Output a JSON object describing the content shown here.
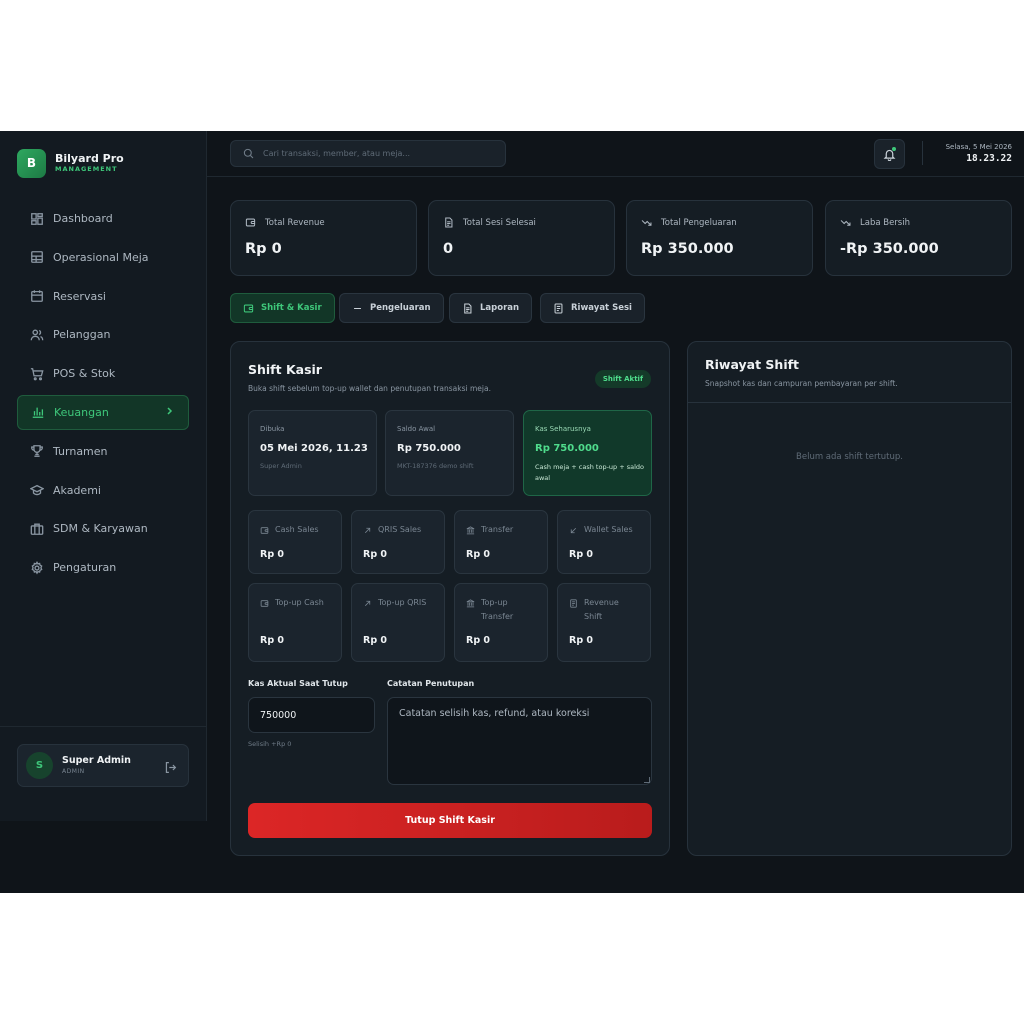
{
  "brand": {
    "logo_letter": "B",
    "name": "Bilyard Pro",
    "subtitle": "MANAGEMENT"
  },
  "sidebar": {
    "items": [
      {
        "label": "Dashboard",
        "icon": "dashboard-icon"
      },
      {
        "label": "Operasional Meja",
        "icon": "table-grid-icon"
      },
      {
        "label": "Reservasi",
        "icon": "calendar-icon"
      },
      {
        "label": "Pelanggan",
        "icon": "users-icon"
      },
      {
        "label": "POS & Stok",
        "icon": "cart-icon"
      },
      {
        "label": "Keuangan",
        "icon": "bar-chart-icon",
        "active": true
      },
      {
        "label": "Turnamen",
        "icon": "trophy-icon"
      },
      {
        "label": "Akademi",
        "icon": "graduation-cap-icon"
      },
      {
        "label": "SDM & Karyawan",
        "icon": "briefcase-icon"
      },
      {
        "label": "Pengaturan",
        "icon": "gear-icon"
      }
    ]
  },
  "user": {
    "initial": "S",
    "name": "Super Admin",
    "role": "ADMIN"
  },
  "header": {
    "search_placeholder": "Cari transaksi, member, atau meja...",
    "date": "Selasa, 5 Mei 2026",
    "time": "18.23.22"
  },
  "stats": [
    {
      "label": "Total Revenue",
      "value": "Rp 0",
      "icon": "wallet-icon"
    },
    {
      "label": "Total Sesi Selesai",
      "value": "0",
      "icon": "document-icon"
    },
    {
      "label": "Total Pengeluaran",
      "value": "Rp 350.000",
      "icon": "trend-down-icon"
    },
    {
      "label": "Laba Bersih",
      "value": "-Rp 350.000",
      "icon": "trend-down-icon"
    }
  ],
  "tabs": [
    {
      "label": "Shift & Kasir",
      "icon": "wallet-icon",
      "active": true
    },
    {
      "label": "Pengeluaran",
      "icon": "minus-icon"
    },
    {
      "label": "Laporan",
      "icon": "document-icon"
    },
    {
      "label": "Riwayat Sesi",
      "icon": "receipt-icon"
    }
  ],
  "shift": {
    "title": "Shift Kasir",
    "subtitle": "Buka shift sebelum top-up wallet dan penutupan transaksi meja.",
    "badge": "Shift Aktif",
    "info": [
      {
        "label": "Dibuka",
        "value": "05 Mei 2026, 11.23",
        "note": "Super Admin"
      },
      {
        "label": "Saldo Awal",
        "value": "Rp 750.000",
        "note": "MKT-187376 demo shift"
      },
      {
        "label": "Kas Seharusnya",
        "value": "Rp 750.000",
        "note": "Cash meja + cash top-up + saldo awal"
      }
    ],
    "metrics_row1": [
      {
        "label": "Cash Sales",
        "value": "Rp 0",
        "icon": "wallet-icon"
      },
      {
        "label": "QRIS Sales",
        "value": "Rp 0",
        "icon": "arrow-up-right-icon"
      },
      {
        "label": "Transfer",
        "value": "Rp 0",
        "icon": "bank-icon"
      },
      {
        "label": "Wallet Sales",
        "value": "Rp 0",
        "icon": "arrow-down-left-icon"
      }
    ],
    "metrics_row2": [
      {
        "label": "Top-up Cash",
        "value": "Rp 0",
        "icon": "wallet-icon"
      },
      {
        "label": "Top-up QRIS",
        "value": "Rp 0",
        "icon": "arrow-up-right-icon"
      },
      {
        "label": "Top-up Transfer",
        "value": "Rp 0",
        "icon": "bank-icon"
      },
      {
        "label": "Revenue Shift",
        "value": "Rp 0",
        "icon": "receipt-icon"
      }
    ],
    "cash_label": "Kas Aktual Saat Tutup",
    "cash_value": "750000",
    "selisih": "Selisih +Rp 0",
    "notes_label": "Catatan Penutupan",
    "notes_placeholder": "Catatan selisih kas, refund, atau koreksi",
    "close_button": "Tutup Shift Kasir"
  },
  "history": {
    "title": "Riwayat Shift",
    "subtitle": "Snapshot kas dan campuran pembayaran per shift.",
    "empty": "Belum ada shift tertutup."
  },
  "colors": {
    "accent": "#3ec77a",
    "danger": "#dc2626",
    "background": "#0f1419"
  }
}
